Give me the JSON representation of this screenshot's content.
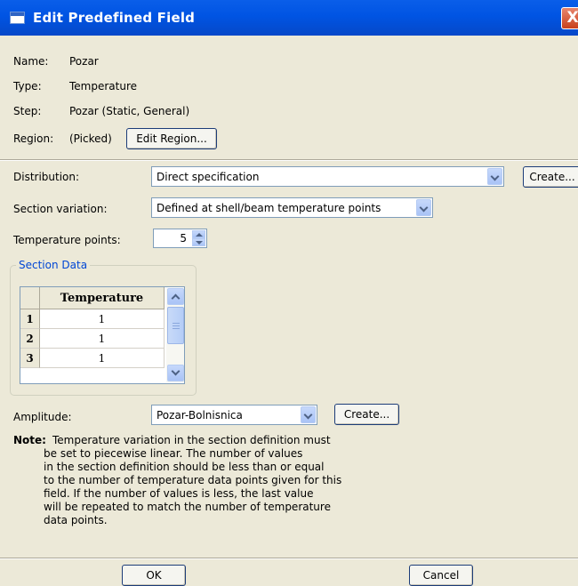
{
  "window": {
    "title": "Edit Predefined Field",
    "close_glyph": "X"
  },
  "info": {
    "name_label": "Name:",
    "name_value": "Pozar",
    "type_label": "Type:",
    "type_value": "Temperature",
    "step_label": "Step:",
    "step_value": "Pozar (Static, General)",
    "region_label": "Region:",
    "region_value": "(Picked)",
    "edit_region_button": "Edit Region..."
  },
  "distribution": {
    "label": "Distribution:",
    "value": "Direct specification",
    "create_button": "Create..."
  },
  "section_variation": {
    "label": "Section variation:",
    "value": "Defined at shell/beam temperature points"
  },
  "temperature_points": {
    "label": "Temperature points:",
    "value": "5"
  },
  "section_data": {
    "title": "Section Data",
    "column_header": "Temperature",
    "rows": [
      {
        "index": "1",
        "value": "1"
      },
      {
        "index": "2",
        "value": "1"
      },
      {
        "index": "3",
        "value": "1"
      }
    ]
  },
  "amplitude": {
    "label": "Amplitude:",
    "value": "Pozar-Bolnisnica",
    "create_button": "Create..."
  },
  "note": {
    "heading": "Note:",
    "lines": [
      "Temperature variation in the section definition must",
      "be set to piecewise linear. The number of values",
      "in the section definition should be less than or equal",
      "to the number of temperature data points given for this",
      "field.  If the number of values is less, the last value",
      "will be repeated to match the number of temperature",
      "data points."
    ]
  },
  "footer": {
    "ok_button": "OK",
    "cancel_button": "Cancel"
  },
  "colors": {
    "titlebar": "#0054e3",
    "dialog_bg": "#ece9d8",
    "group_title": "#0046d5"
  },
  "icons": [
    "window-icon",
    "close-icon",
    "chevron-down-icon",
    "spinner-up-icon",
    "spinner-down-icon",
    "scroll-up-icon",
    "scroll-down-icon"
  ]
}
